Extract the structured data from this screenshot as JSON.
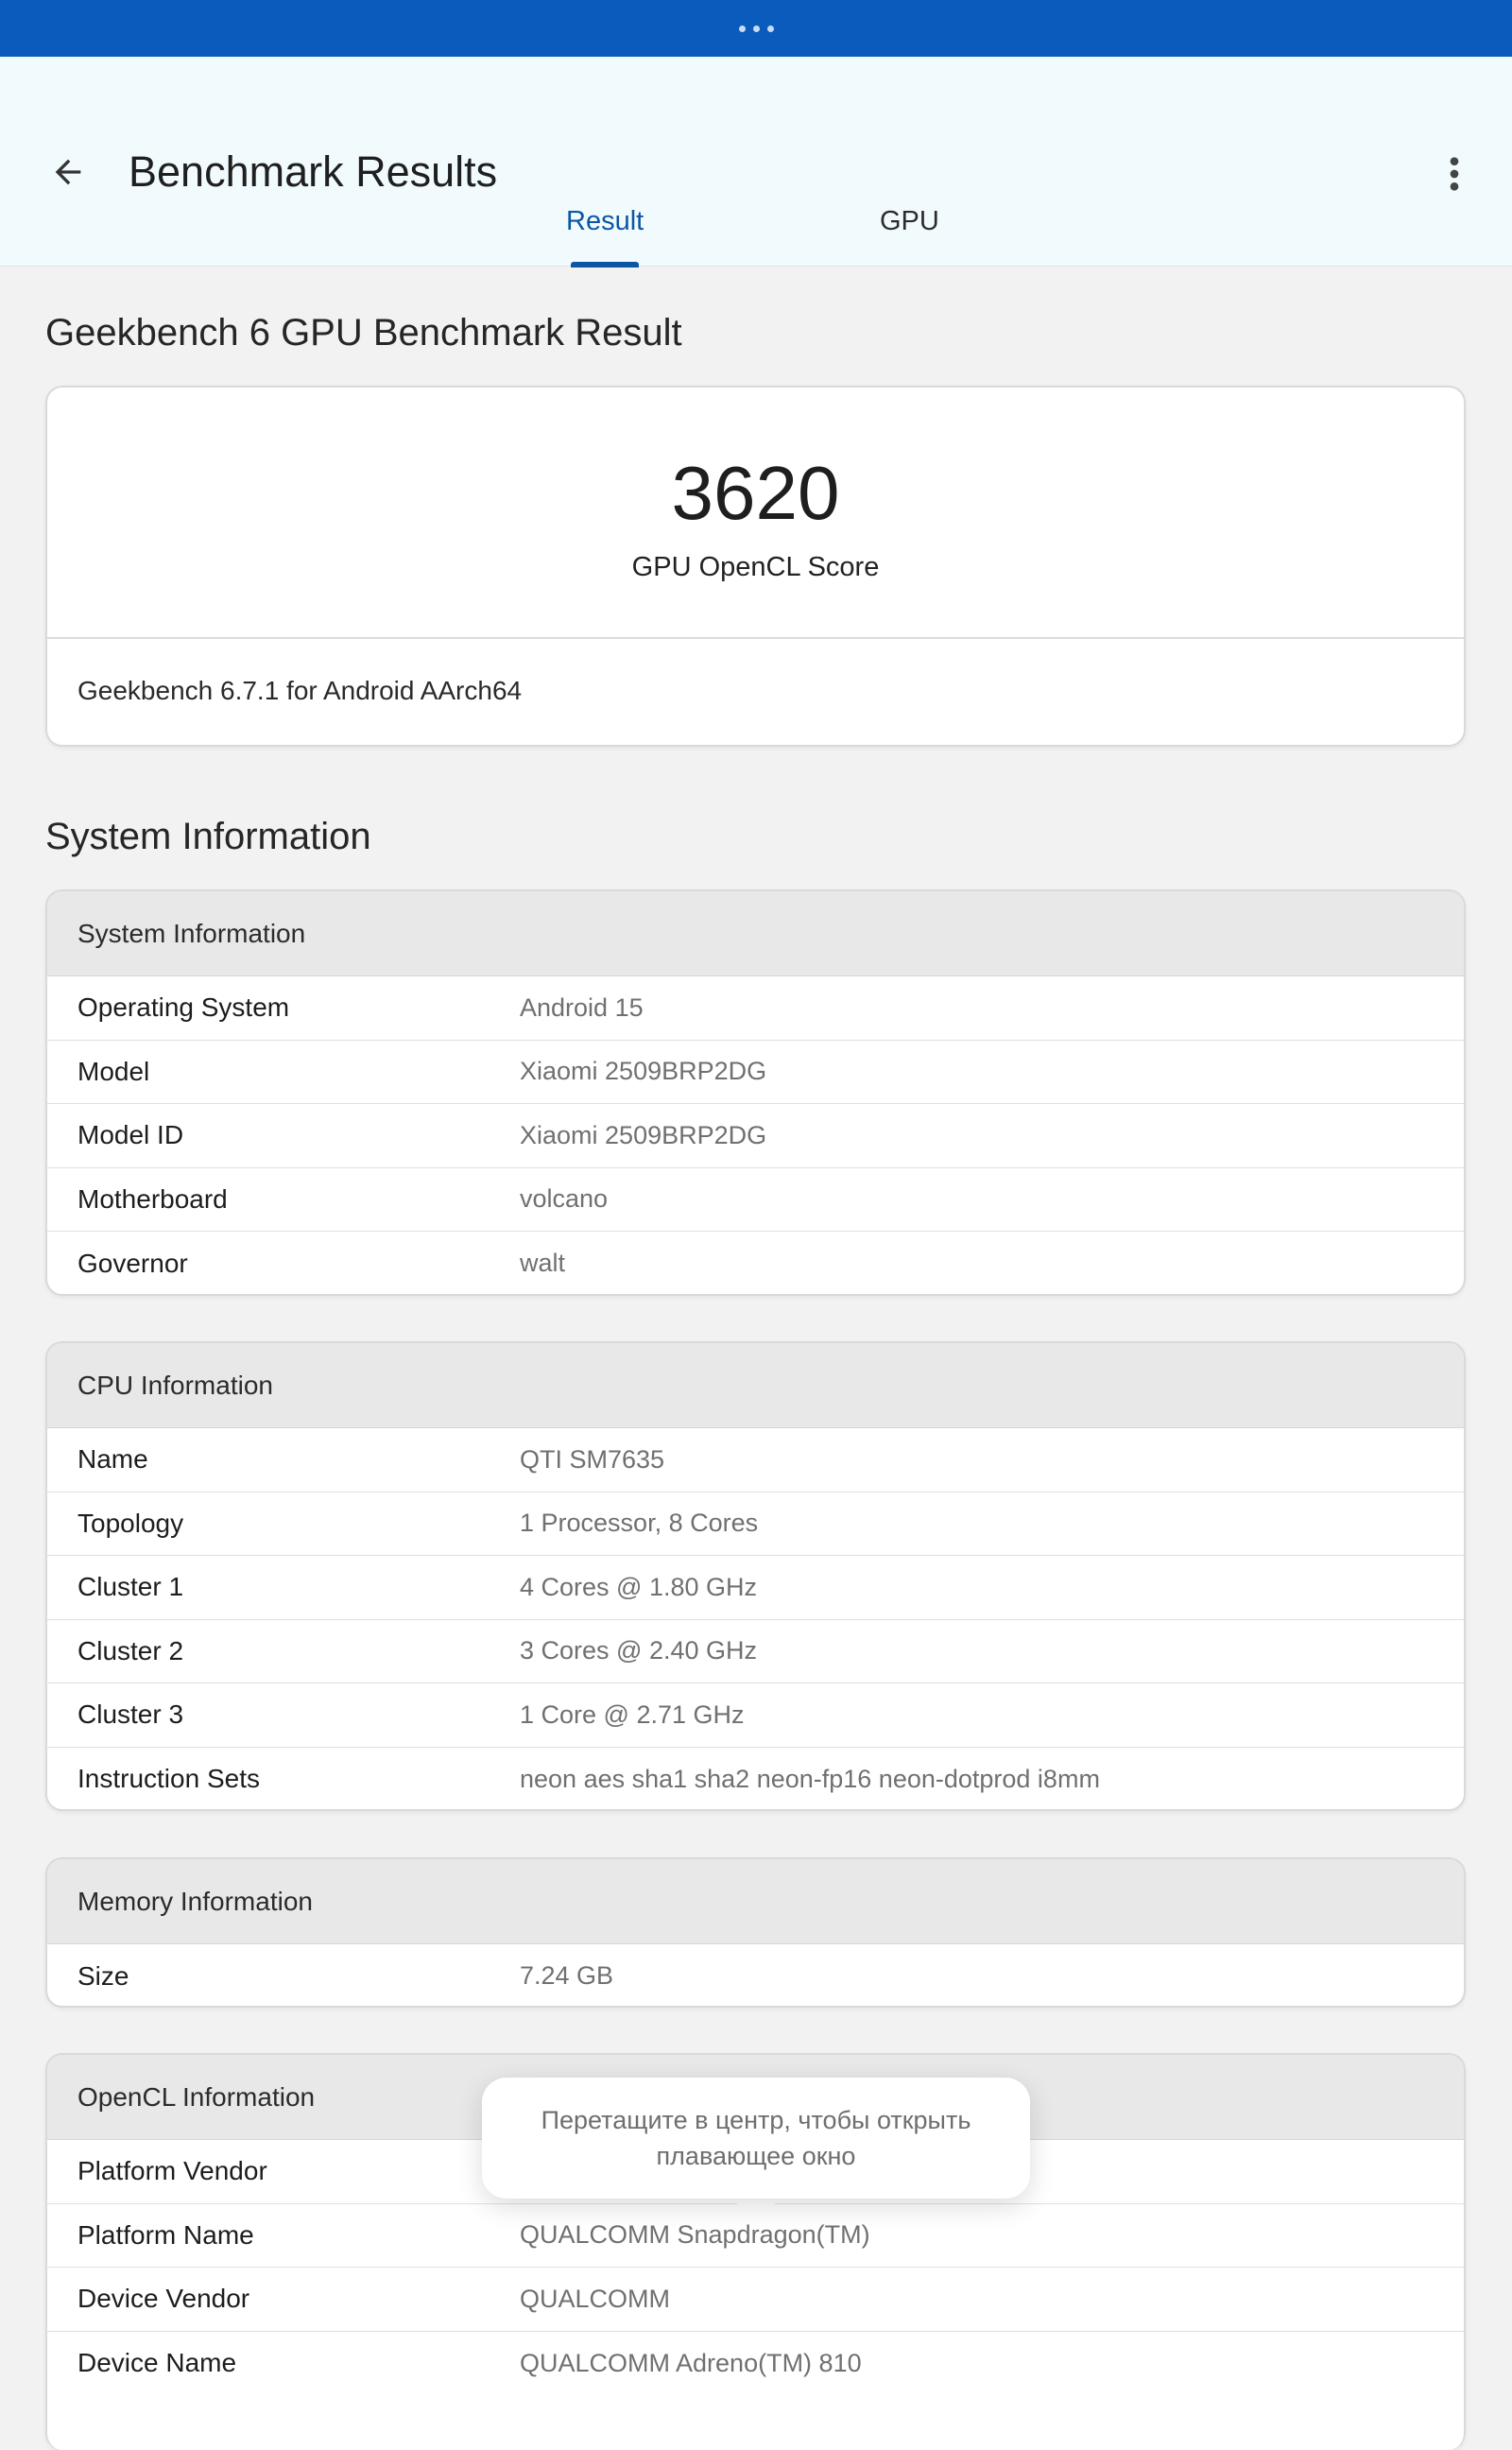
{
  "app": {
    "title": "Benchmark Results",
    "tabs": [
      {
        "label": "Result",
        "active": true
      },
      {
        "label": "GPU",
        "active": false
      }
    ]
  },
  "result": {
    "heading": "Geekbench 6 GPU Benchmark Result",
    "score": "3620",
    "score_label": "GPU OpenCL Score",
    "version": "Geekbench 6.7.1 for Android AArch64"
  },
  "system_section_heading": "System Information",
  "cards": [
    {
      "title": "System Information",
      "rows": [
        {
          "label": "Operating System",
          "value": "Android 15"
        },
        {
          "label": "Model",
          "value": "Xiaomi 2509BRP2DG"
        },
        {
          "label": "Model ID",
          "value": "Xiaomi 2509BRP2DG"
        },
        {
          "label": "Motherboard",
          "value": "volcano"
        },
        {
          "label": "Governor",
          "value": "walt"
        }
      ]
    },
    {
      "title": "CPU Information",
      "rows": [
        {
          "label": "Name",
          "value": "QTI SM7635"
        },
        {
          "label": "Topology",
          "value": "1 Processor, 8 Cores"
        },
        {
          "label": "Cluster 1",
          "value": "4 Cores @ 1.80 GHz"
        },
        {
          "label": "Cluster 2",
          "value": "3 Cores @ 2.40 GHz"
        },
        {
          "label": "Cluster 3",
          "value": "1 Core @ 2.71 GHz"
        },
        {
          "label": "Instruction Sets",
          "value": "neon aes sha1 sha2 neon-fp16 neon-dotprod i8mm"
        }
      ]
    },
    {
      "title": "Memory Information",
      "rows": [
        {
          "label": "Size",
          "value": "7.24 GB"
        }
      ]
    },
    {
      "title": "OpenCL Information",
      "rows": [
        {
          "label": "Platform Vendor",
          "value": ""
        },
        {
          "label": "Platform Name",
          "value": "QUALCOMM Snapdragon(TM)"
        },
        {
          "label": "Device Vendor",
          "value": "QUALCOMM"
        },
        {
          "label": "Device Name",
          "value": "QUALCOMM Adreno(TM) 810"
        }
      ]
    }
  ],
  "toast": {
    "text": "Перетащите в центр, чтобы открыть плавающее окно"
  },
  "colors": {
    "status_strip": "#0b5bbd",
    "appbar_bg": "#f1fbfd",
    "accent": "#0b57a4",
    "page_bg": "#f2f2f2",
    "card_header_bg": "#e8e8e8"
  }
}
